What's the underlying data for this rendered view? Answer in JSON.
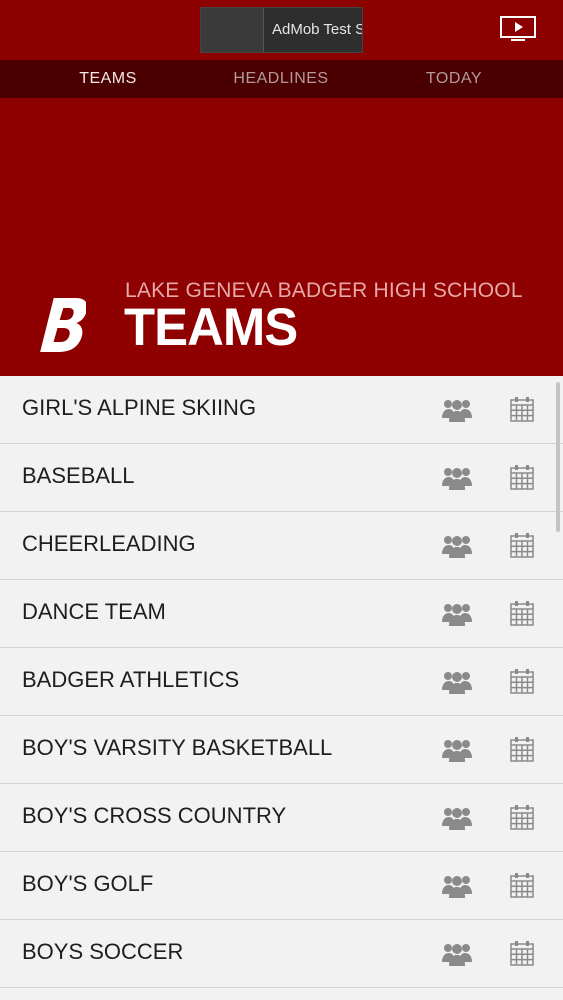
{
  "ad": {
    "text": "AdMob Test S"
  },
  "top_icons": {
    "video": "video-play-icon"
  },
  "tabs": [
    {
      "label": "TEAMS",
      "active": true
    },
    {
      "label": "HEADLINES",
      "active": false
    },
    {
      "label": "TODAY",
      "active": false
    }
  ],
  "hero": {
    "logo_icon": "badger-b-logo",
    "school_name": "LAKE GENEVA BADGER HIGH SCHOOL",
    "title": "TEAMS"
  },
  "teams": [
    {
      "name": "GIRL'S ALPINE SKIING"
    },
    {
      "name": "BASEBALL"
    },
    {
      "name": "CHEERLEADING"
    },
    {
      "name": "DANCE TEAM"
    },
    {
      "name": "BADGER ATHLETICS"
    },
    {
      "name": "BOY'S VARSITY BASKETBALL"
    },
    {
      "name": "BOY'S CROSS COUNTRY"
    },
    {
      "name": "BOY'S GOLF"
    },
    {
      "name": "BOYS SOCCER"
    }
  ],
  "row_icons": {
    "roster": "people-group-icon",
    "schedule": "calendar-icon"
  },
  "colors": {
    "brand_red": "#8f0000",
    "tab_bar": "#4a0000",
    "list_bg": "#f2f2f2",
    "icon_gray": "#8a8a8a"
  }
}
